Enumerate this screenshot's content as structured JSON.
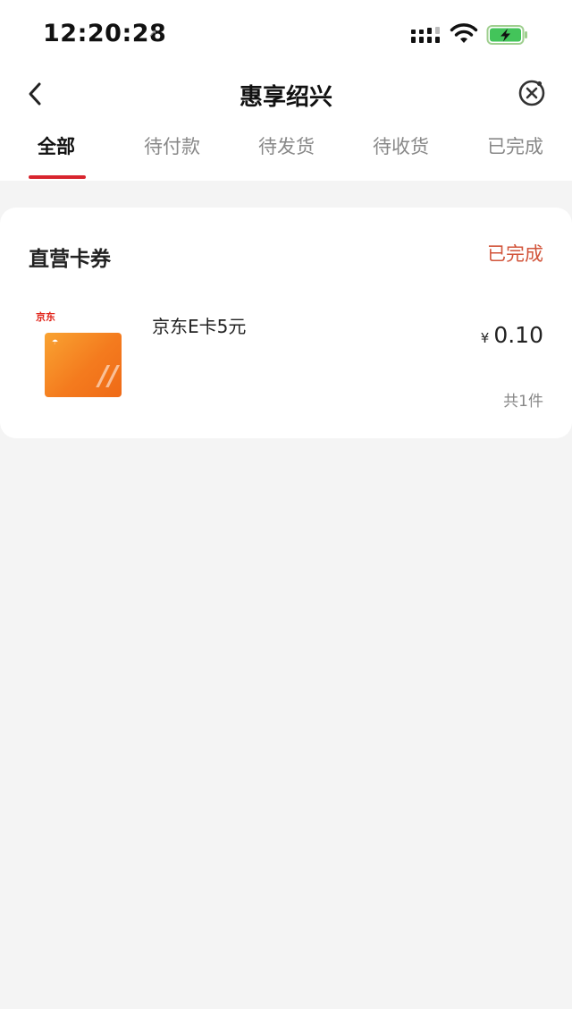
{
  "status_bar": {
    "time": "12:20:28"
  },
  "nav": {
    "title": "惠享绍兴"
  },
  "tabs": [
    {
      "label": "全部",
      "active": true
    },
    {
      "label": "待付款",
      "active": false
    },
    {
      "label": "待发货",
      "active": false
    },
    {
      "label": "待收货",
      "active": false
    },
    {
      "label": "已完成",
      "active": false
    }
  ],
  "colors": {
    "accent": "#d8252e",
    "status_text": "#d2553b",
    "background": "#f4f4f4"
  },
  "order": {
    "store_name": "直营卡券",
    "status": "已完成",
    "product": {
      "thumbnail_logo": "京东",
      "name": "京东E卡5元",
      "currency": "¥",
      "price": "0.10",
      "count_text": "共1件"
    }
  }
}
